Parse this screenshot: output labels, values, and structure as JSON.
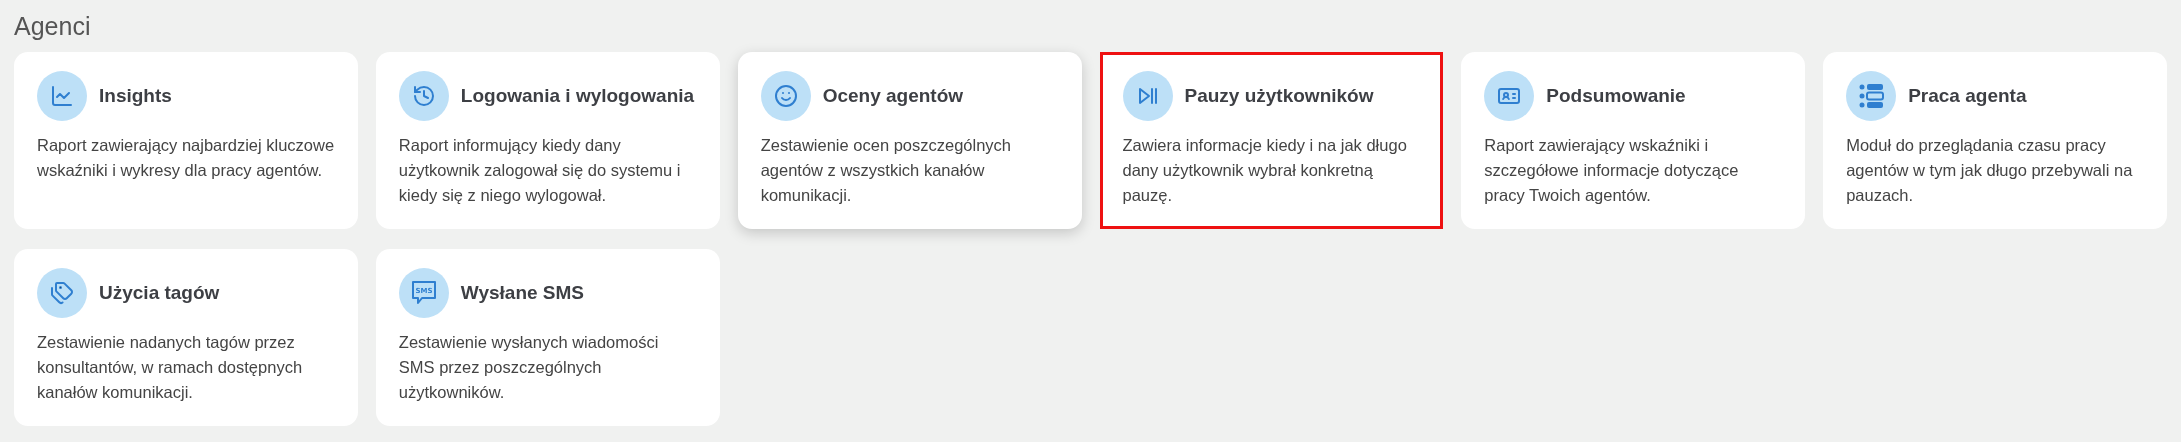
{
  "section_title": "Agenci",
  "cards": [
    {
      "title": "Insights",
      "description": "Raport zawierający najbardziej kluczowe wskaźniki i wykresy dla pracy agentów.",
      "highlighted": false,
      "hovered": false
    },
    {
      "title": "Logowania i wylogowania",
      "description": "Raport informujący kiedy dany użytkownik zalogował się do systemu i kiedy się z niego wylogował.",
      "highlighted": false,
      "hovered": false
    },
    {
      "title": "Oceny agentów",
      "description": "Zestawienie ocen poszczególnych agentów z wszystkich kanałów komunikacji.",
      "highlighted": false,
      "hovered": true
    },
    {
      "title": "Pauzy użytkowników",
      "description": "Zawiera informacje kiedy i na jak długo dany użytkownik wybrał konkretną pauzę.",
      "highlighted": true,
      "hovered": false
    },
    {
      "title": "Podsumowanie",
      "description": "Raport zawierający wskaźniki i szczegółowe informacje dotyczące pracy Twoich agentów.",
      "highlighted": false,
      "hovered": false
    },
    {
      "title": "Praca agenta",
      "description": "Moduł do przeglądania czasu pracy agentów w tym jak długo przebywali na pauzach.",
      "highlighted": false,
      "hovered": false
    },
    {
      "title": "Użycia tagów",
      "description": "Zestawienie nadanych tagów przez konsultantów, w ramach dostępnych kanałów komunikacji.",
      "highlighted": false,
      "hovered": false
    },
    {
      "title": "Wysłane SMS",
      "description": "Zestawienie wysłanych wiadomości SMS przez poszczególnych użytkowników.",
      "highlighted": false,
      "hovered": false,
      "icon_text": "SMS"
    }
  ]
}
